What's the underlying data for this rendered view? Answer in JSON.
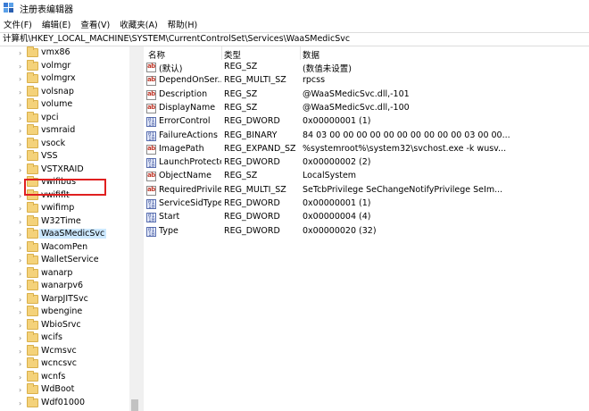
{
  "window": {
    "title": "注册表编辑器"
  },
  "menubar": {
    "items": [
      "文件(F)",
      "编辑(E)",
      "查看(V)",
      "收藏夹(A)",
      "帮助(H)"
    ]
  },
  "address": "计算机\\HKEY_LOCAL_MACHINE\\SYSTEM\\CurrentControlSet\\Services\\WaaSMedicSvc",
  "tree": {
    "selected": "WaaSMedicSvc",
    "items": [
      {
        "label": "vmx86",
        "expandable": true
      },
      {
        "label": "volmgr",
        "expandable": true
      },
      {
        "label": "volmgrx",
        "expandable": true
      },
      {
        "label": "volsnap",
        "expandable": true
      },
      {
        "label": "volume",
        "expandable": true
      },
      {
        "label": "vpci",
        "expandable": true
      },
      {
        "label": "vsmraid",
        "expandable": true
      },
      {
        "label": "vsock",
        "expandable": true
      },
      {
        "label": "VSS",
        "expandable": true
      },
      {
        "label": "VSTXRAID",
        "expandable": true
      },
      {
        "label": "vwifibus",
        "expandable": true
      },
      {
        "label": "vwififlt",
        "expandable": true
      },
      {
        "label": "vwifimp",
        "expandable": true
      },
      {
        "label": "W32Time",
        "expandable": true
      },
      {
        "label": "WaaSMedicSvc",
        "expandable": true
      },
      {
        "label": "WacomPen",
        "expandable": true
      },
      {
        "label": "WalletService",
        "expandable": true
      },
      {
        "label": "wanarp",
        "expandable": true
      },
      {
        "label": "wanarpv6",
        "expandable": true
      },
      {
        "label": "WarpJITSvc",
        "expandable": true
      },
      {
        "label": "wbengine",
        "expandable": true
      },
      {
        "label": "WbioSrvc",
        "expandable": true
      },
      {
        "label": "wcifs",
        "expandable": true
      },
      {
        "label": "Wcmsvc",
        "expandable": true
      },
      {
        "label": "wcncsvc",
        "expandable": true
      },
      {
        "label": "wcnfs",
        "expandable": true
      },
      {
        "label": "WdBoot",
        "expandable": true
      },
      {
        "label": "Wdf01000",
        "expandable": true
      }
    ]
  },
  "values": {
    "headers": {
      "name": "名称",
      "type": "类型",
      "data": "数据"
    },
    "rows": [
      {
        "icon": "string-value-icon",
        "name": "(默认)",
        "type": "REG_SZ",
        "data": "(数值未设置)"
      },
      {
        "icon": "string-value-icon",
        "name": "DependOnSer...",
        "type": "REG_MULTI_SZ",
        "data": "rpcss"
      },
      {
        "icon": "string-value-icon",
        "name": "Description",
        "type": "REG_SZ",
        "data": "@WaaSMedicSvc.dll,-101"
      },
      {
        "icon": "string-value-icon",
        "name": "DisplayName",
        "type": "REG_SZ",
        "data": "@WaaSMedicSvc.dll,-100"
      },
      {
        "icon": "binary-value-icon",
        "name": "ErrorControl",
        "type": "REG_DWORD",
        "data": "0x00000001 (1)"
      },
      {
        "icon": "binary-value-icon",
        "name": "FailureActions",
        "type": "REG_BINARY",
        "data": "84 03 00 00 00 00 00 00 00 00 00 00 03 00 00..."
      },
      {
        "icon": "string-value-icon",
        "name": "ImagePath",
        "type": "REG_EXPAND_SZ",
        "data": "%systemroot%\\system32\\svchost.exe -k wusv..."
      },
      {
        "icon": "binary-value-icon",
        "name": "LaunchProtected",
        "type": "REG_DWORD",
        "data": "0x00000002 (2)"
      },
      {
        "icon": "string-value-icon",
        "name": "ObjectName",
        "type": "REG_SZ",
        "data": "LocalSystem"
      },
      {
        "icon": "string-value-icon",
        "name": "RequiredPrivile...",
        "type": "REG_MULTI_SZ",
        "data": "SeTcbPrivilege SeChangeNotifyPrivilege SeIm..."
      },
      {
        "icon": "binary-value-icon",
        "name": "ServiceSidType",
        "type": "REG_DWORD",
        "data": "0x00000001 (1)"
      },
      {
        "icon": "binary-value-icon",
        "name": "Start",
        "type": "REG_DWORD",
        "data": "0x00000004 (4)"
      },
      {
        "icon": "binary-value-icon",
        "name": "Type",
        "type": "REG_DWORD",
        "data": "0x00000020 (32)"
      }
    ]
  },
  "colors": {
    "selection": "#cce8ff",
    "highlight_box": "#e02020",
    "folder": "#f4d27a"
  }
}
